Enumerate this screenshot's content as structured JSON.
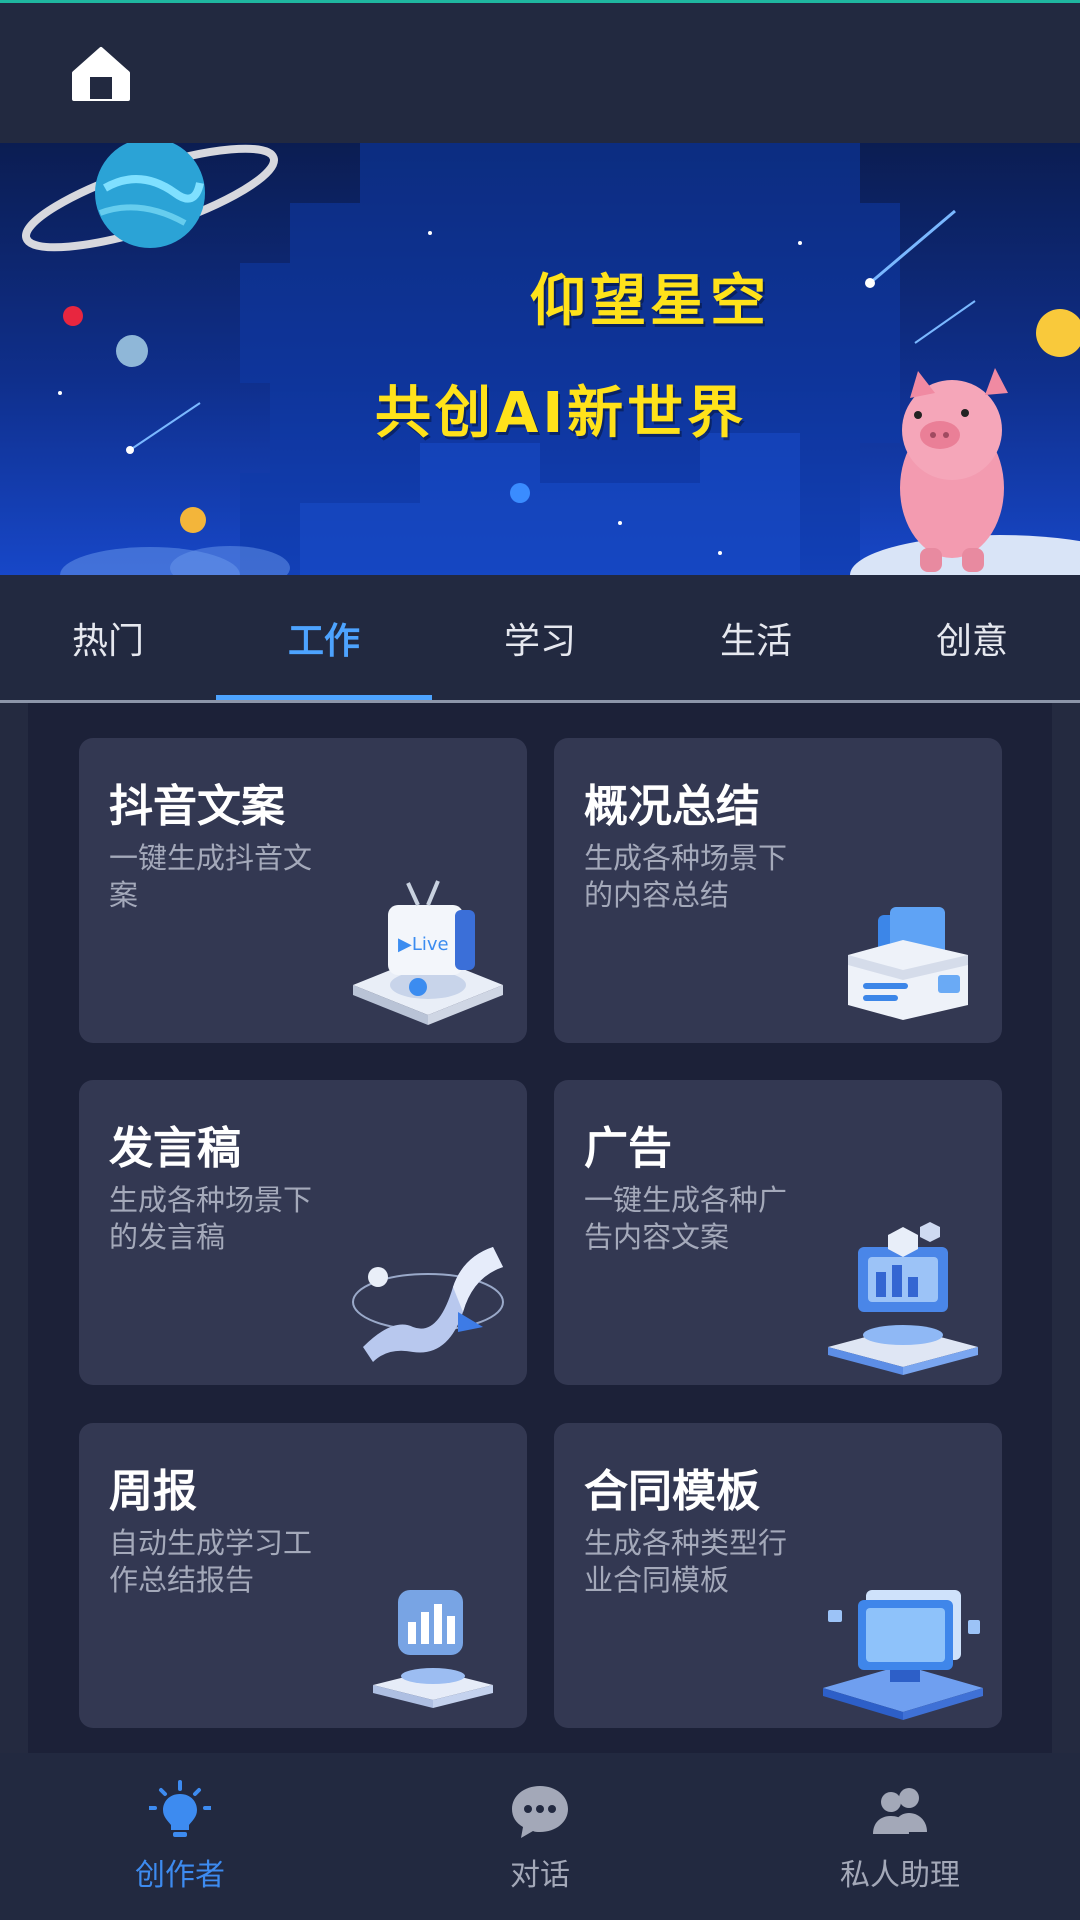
{
  "header": {
    "home_icon": "home-icon"
  },
  "banner": {
    "line1": "仰望星空",
    "line2": "共创AI新世界"
  },
  "tabs": [
    {
      "label": "热门",
      "active": false
    },
    {
      "label": "工作",
      "active": true
    },
    {
      "label": "学习",
      "active": false
    },
    {
      "label": "生活",
      "active": false
    },
    {
      "label": "创意",
      "active": false
    }
  ],
  "cards": [
    {
      "title": "抖音文案",
      "desc": "一键生成抖音文案",
      "icon": "live-tv-icon"
    },
    {
      "title": "概况总结",
      "desc": "生成各种场景下的内容总结",
      "icon": "file-box-icon"
    },
    {
      "title": "发言稿",
      "desc": "生成各种场景下的发言稿",
      "icon": "scroll-icon"
    },
    {
      "title": "广告",
      "desc": "一键生成各种广告内容文案",
      "icon": "ad-platform-icon"
    },
    {
      "title": "周报",
      "desc": "自动生成学习工作总结报告",
      "icon": "report-chart-icon"
    },
    {
      "title": "合同模板",
      "desc": "生成各种类型行业合同模板",
      "icon": "contract-monitor-icon"
    }
  ],
  "bottom_nav": [
    {
      "label": "创作者",
      "icon": "lightbulb-icon",
      "active": true
    },
    {
      "label": "对话",
      "icon": "chat-bubble-icon",
      "active": false
    },
    {
      "label": "私人助理",
      "icon": "people-icon",
      "active": false
    }
  ],
  "colors": {
    "accent": "#4da3ff",
    "banner_text": "#ffe21a",
    "background": "#242a40",
    "card": "#333852"
  }
}
